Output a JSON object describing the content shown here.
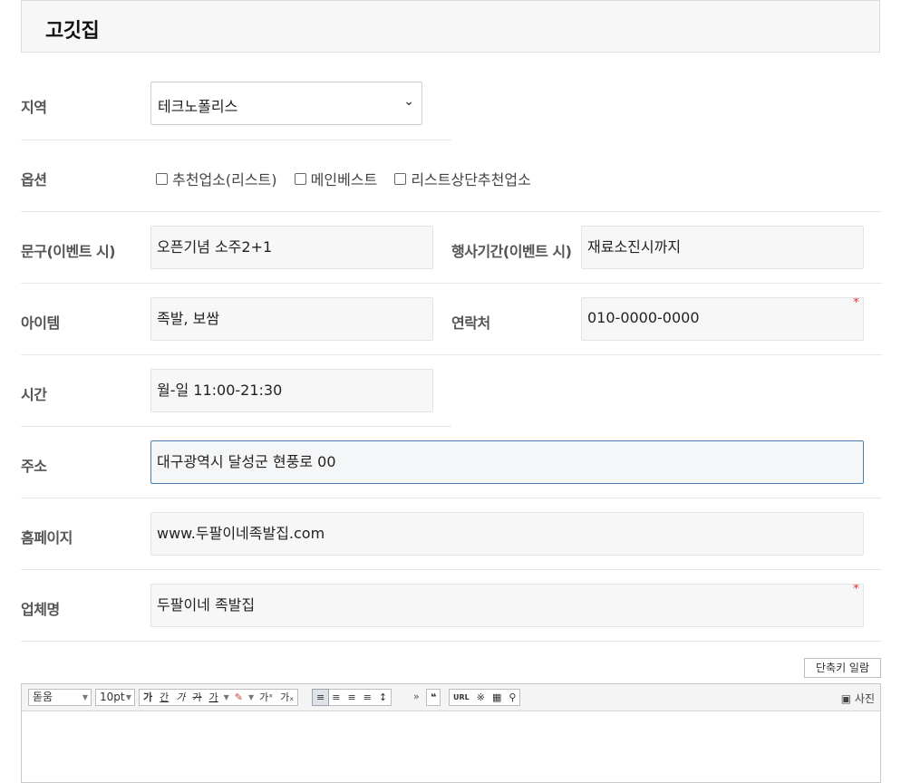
{
  "header": {
    "title": "고깃집"
  },
  "labels": {
    "region": "지역",
    "options": "옵션",
    "phrase": "문구(이벤트 시)",
    "event_period": "행사기간(이벤트 시)",
    "item": "아이템",
    "contact": "연락처",
    "hours": "시간",
    "address": "주소",
    "homepage": "홈페이지",
    "business_name": "업체명"
  },
  "fields": {
    "region_selected": "테크노폴리스",
    "phrase": "오픈기념 소주2+1",
    "event_period": "재료소진시까지",
    "item": "족발, 보쌈",
    "contact": "010-0000-0000",
    "hours": "월-일 11:00-21:30",
    "address": "대구광역시 달성군 현풍로 00",
    "homepage": "www.두팔이네족발집.com",
    "business_name": "두팔이네 족발집"
  },
  "required_mark": "*",
  "options": [
    {
      "label": "추천업소(리스트)",
      "checked": false
    },
    {
      "label": "메인베스트",
      "checked": false
    },
    {
      "label": "리스트상단추천업소",
      "checked": false
    }
  ],
  "editor": {
    "shortcut_button": "단축키 일람",
    "font_family": "돋움",
    "font_size": "10pt",
    "photo_button": "사진",
    "tools": {
      "bold": "가",
      "underline": "간",
      "italic": "가",
      "strike": "가",
      "font_color": "가",
      "superscript": "가ˣ",
      "subscript": "가ₓ",
      "more": "»",
      "quote": "❝",
      "url": "URL",
      "special_char": "※"
    }
  },
  "colors": {
    "focus_border": "#4a7fb3",
    "required": "#e23a3a"
  }
}
